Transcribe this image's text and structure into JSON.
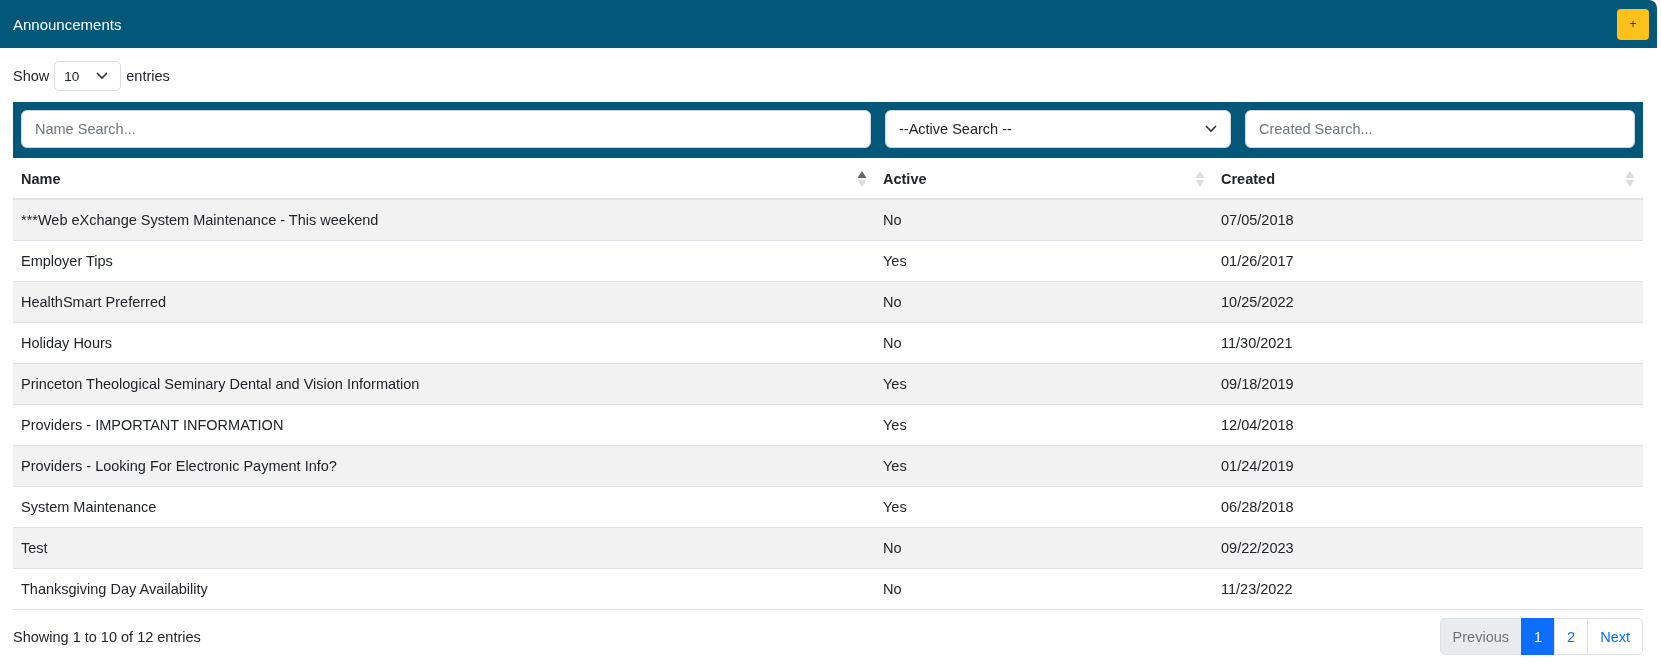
{
  "panel": {
    "title": "Announcements",
    "add_button": "+"
  },
  "length_menu": {
    "before": "Show",
    "value": "10",
    "after": "entries"
  },
  "filters": [
    {
      "kind": "text",
      "placeholder": "Name Search..."
    },
    {
      "kind": "select",
      "value": "--Active Search --"
    },
    {
      "kind": "text",
      "placeholder": "Created Search..."
    }
  ],
  "table": {
    "columns": [
      {
        "label": "Name",
        "sorted": true
      },
      {
        "label": "Active",
        "sorted": false
      },
      {
        "label": "Created",
        "sorted": false
      }
    ],
    "rows": [
      [
        "***Web eXchange System Maintenance - This weekend",
        "No",
        "07/05/2018"
      ],
      [
        "Employer Tips",
        "Yes",
        "01/26/2017"
      ],
      [
        "HealthSmart Preferred",
        "No",
        "10/25/2022"
      ],
      [
        "Holiday Hours",
        "No",
        "11/30/2021"
      ],
      [
        "Princeton Theological Seminary Dental and Vision Information",
        "Yes",
        "09/18/2019"
      ],
      [
        "Providers - IMPORTANT INFORMATION",
        "Yes",
        "12/04/2018"
      ],
      [
        "Providers - Looking For Electronic Payment Info?",
        "Yes",
        "01/24/2019"
      ],
      [
        "System Maintenance",
        "Yes",
        "06/28/2018"
      ],
      [
        "Test",
        "No",
        "09/22/2023"
      ],
      [
        "Thanksgiving Day Availability",
        "No",
        "11/23/2022"
      ]
    ]
  },
  "info": "Showing 1 to 10 of 12 entries",
  "pagination": {
    "previous": {
      "label": "Previous",
      "disabled": true
    },
    "pages": [
      {
        "label": "1",
        "selected": true
      },
      {
        "label": "2",
        "selected": false
      }
    ],
    "next": {
      "label": "Next",
      "disabled": false
    }
  }
}
